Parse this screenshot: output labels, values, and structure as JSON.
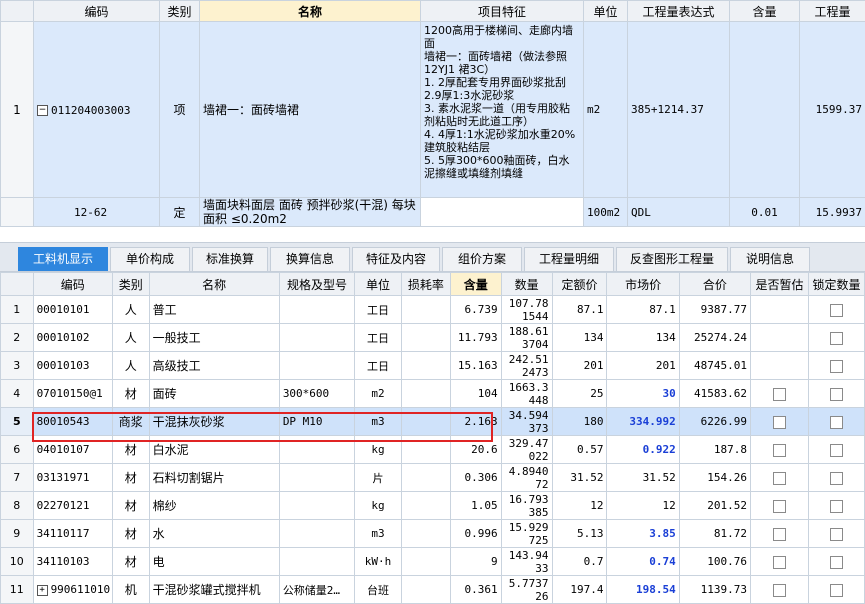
{
  "top_grid": {
    "headers": [
      "编码",
      "类别",
      "名称",
      "项目特征",
      "单位",
      "工程量表达式",
      "含量",
      "工程量"
    ],
    "rows": [
      {
        "index": "1",
        "code": "011204003003",
        "expander": "−",
        "type": "项",
        "name": "墙裙一：面砖墙裙",
        "feature": "1200高用于楼梯间、走廊内墙面\n墙裙一：面砖墙裙（做法参照12YJ1 裙3C）\n1. 2厚配套专用界面砂浆批刮\n2.9厚1:3水泥砂浆\n3. 素水泥浆一道（用专用胶粘剂粘贴时无此道工序）\n4. 4厚1:1水泥砂浆加水重20%建筑胶粘结层\n5. 5厚300*600釉面砖，白水泥擦缝或填缝剂填缝",
        "unit": "m2",
        "expr": "385+1214.37",
        "content": "",
        "qty": "1599.37"
      },
      {
        "index": "",
        "code": "12-62",
        "type": "定",
        "name": "墙面块料面层 面砖 预拌砂浆(干混) 每块面积 ≤0.20m2",
        "feature": "",
        "unit": "100m2",
        "expr": "QDL",
        "content": "0.01",
        "qty": "15.9937"
      }
    ]
  },
  "tabs": [
    "工料机显示",
    "单价构成",
    "标准换算",
    "换算信息",
    "特征及内容",
    "组价方案",
    "工程量明细",
    "反查图形工程量",
    "说明信息"
  ],
  "bottom_grid": {
    "headers": [
      "编码",
      "类别",
      "名称",
      "规格及型号",
      "单位",
      "损耗率",
      "含量",
      "数量",
      "定额价",
      "市场价",
      "合价",
      "是否暂估",
      "锁定数量"
    ],
    "rows": [
      {
        "index": "1",
        "code": "00010101",
        "type": "人",
        "name": "普工",
        "spec": "",
        "unit": "工日",
        "loss": "",
        "content": "6.739",
        "quantity": "107.781544",
        "price": "87.1",
        "market": "87.1",
        "market_blue": false,
        "total": "9387.77",
        "estimate_cb": false,
        "lock_cb": true
      },
      {
        "index": "2",
        "code": "00010102",
        "type": "人",
        "name": "一般技工",
        "spec": "",
        "unit": "工日",
        "loss": "",
        "content": "11.793",
        "quantity": "188.613704",
        "price": "134",
        "market": "134",
        "market_blue": false,
        "total": "25274.24",
        "estimate_cb": false,
        "lock_cb": true
      },
      {
        "index": "3",
        "code": "00010103",
        "type": "人",
        "name": "高级技工",
        "spec": "",
        "unit": "工日",
        "loss": "",
        "content": "15.163",
        "quantity": "242.512473",
        "price": "201",
        "market": "201",
        "market_blue": false,
        "total": "48745.01",
        "estimate_cb": false,
        "lock_cb": true
      },
      {
        "index": "4",
        "code": "07010150@1",
        "type": "材",
        "name": "面砖",
        "spec": "300*600",
        "unit": "m2",
        "loss": "",
        "content": "104",
        "quantity": "1663.3448",
        "price": "25",
        "market": "30",
        "market_blue": true,
        "total": "41583.62",
        "estimate_cb": true,
        "lock_cb": true
      },
      {
        "index": "5",
        "code": "80010543",
        "type": "商浆",
        "name": "干混抹灰砂浆",
        "spec": "DP M10",
        "unit": "m3",
        "loss": "",
        "content": "2.163",
        "quantity": "34.594373",
        "price": "180",
        "market": "334.992",
        "market_blue": true,
        "total": "6226.99",
        "estimate_cb": true,
        "lock_cb": true
      },
      {
        "index": "6",
        "code": "04010107",
        "type": "材",
        "name": "白水泥",
        "spec": "",
        "unit": "kg",
        "loss": "",
        "content": "20.6",
        "quantity": "329.47022",
        "price": "0.57",
        "market": "0.922",
        "market_blue": true,
        "total": "187.8",
        "estimate_cb": true,
        "lock_cb": true
      },
      {
        "index": "7",
        "code": "03131971",
        "type": "材",
        "name": "石料切割锯片",
        "spec": "",
        "unit": "片",
        "loss": "",
        "content": "0.306",
        "quantity": "4.894072",
        "price": "31.52",
        "market": "31.52",
        "market_blue": false,
        "total": "154.26",
        "estimate_cb": true,
        "lock_cb": true
      },
      {
        "index": "8",
        "code": "02270121",
        "type": "材",
        "name": "棉纱",
        "spec": "",
        "unit": "kg",
        "loss": "",
        "content": "1.05",
        "quantity": "16.793385",
        "price": "12",
        "market": "12",
        "market_blue": false,
        "total": "201.52",
        "estimate_cb": true,
        "lock_cb": true
      },
      {
        "index": "9",
        "code": "34110117",
        "type": "材",
        "name": "水",
        "spec": "",
        "unit": "m3",
        "loss": "",
        "content": "0.996",
        "quantity": "15.929725",
        "price": "5.13",
        "market": "3.85",
        "market_blue": true,
        "total": "81.72",
        "estimate_cb": true,
        "lock_cb": true
      },
      {
        "index": "10",
        "code": "34110103",
        "type": "材",
        "name": "电",
        "spec": "",
        "unit": "kW·h",
        "loss": "",
        "content": "9",
        "quantity": "143.9433",
        "price": "0.7",
        "market": "0.74",
        "market_blue": true,
        "total": "100.76",
        "estimate_cb": true,
        "lock_cb": true
      },
      {
        "index": "11",
        "code": "990611010",
        "expander": "+",
        "type": "机",
        "name": "干混砂浆罐式搅拌机",
        "spec": "公称储量2…",
        "unit": "台班",
        "loss": "",
        "content": "0.361",
        "quantity": "5.773726",
        "price": "197.4",
        "market": "198.54",
        "market_blue": true,
        "total": "1139.73",
        "estimate_cb": true,
        "lock_cb": true
      }
    ]
  }
}
